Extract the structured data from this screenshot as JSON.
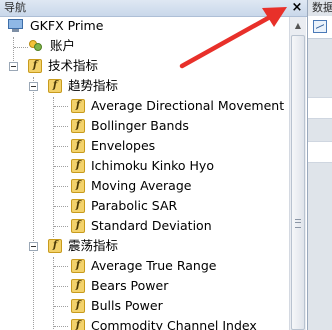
{
  "navigator": {
    "title": "导航",
    "close_label": "×"
  },
  "right_panel": {
    "title": "数据"
  },
  "tree": {
    "root": "GKFX Prime",
    "accounts": "账户",
    "indicators": "技术指标",
    "trend": {
      "label": "趋势指标",
      "items": [
        "Average Directional Movement Ir",
        "Bollinger Bands",
        "Envelopes",
        "Ichimoku Kinko Hyo",
        "Moving Average",
        "Parabolic SAR",
        "Standard Deviation"
      ]
    },
    "oscillators": {
      "label": "震荡指标",
      "items": [
        "Average True Range",
        "Bears Power",
        "Bulls Power",
        "Commodity Channel Index"
      ]
    }
  },
  "icons": {
    "indicator_glyph": "f"
  },
  "colors": {
    "annotation_arrow": "#e8302a",
    "indicator_icon": "#f3d26b",
    "titlebar": "#c9d8ea"
  }
}
